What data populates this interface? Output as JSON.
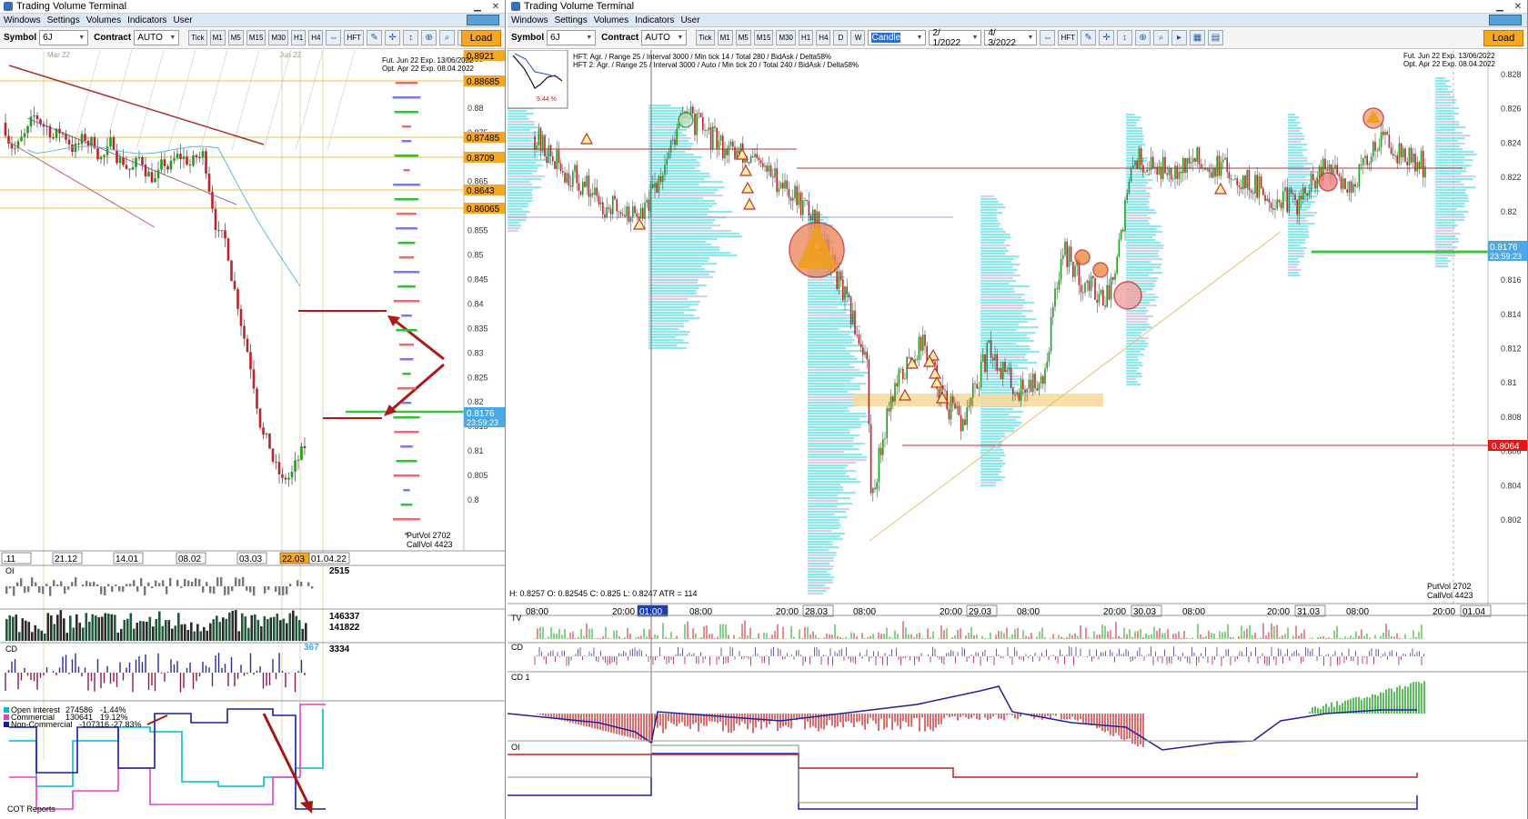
{
  "left_window": {
    "title": "Trading Volume Terminal",
    "menu": [
      "Windows",
      "Settings",
      "Volumes",
      "Indicators",
      "User"
    ],
    "toolbar": {
      "symbol_label": "Symbol",
      "symbol_value": "6J",
      "contract_label": "Contract",
      "contract_value": "AUTO",
      "timeframes": [
        "Tick",
        "M1",
        "M5",
        "M15",
        "M30",
        "H1",
        "H4"
      ],
      "hft_label": "HFT",
      "load_label": "Load"
    },
    "info": [
      "Fut. Jun 22 Exp. 13/06/2022",
      "Opt. Apr 22 Exp. 08.04.2022"
    ],
    "price_axis": [
      "0.89",
      "0.885",
      "0.88",
      "0.875",
      "0.87",
      "0.865",
      "0.86",
      "0.855",
      "0.85",
      "0.845",
      "0.84",
      "0.835",
      "0.83",
      "0.825",
      "0.82",
      "0.815",
      "0.81",
      "0.805",
      "0.8"
    ],
    "price_labels": [
      {
        "text": "0.8921",
        "color": "#f5a623"
      },
      {
        "text": "0.88685",
        "color": "#f5a623"
      },
      {
        "text": "0.87485",
        "color": "#f5a623"
      },
      {
        "text": "0.8709",
        "color": "#f5a623"
      },
      {
        "text": "0.8643",
        "color": "#f5a623"
      },
      {
        "text": "0.86065",
        "color": "#f5a623"
      }
    ],
    "current_price": "0.8176",
    "countdown": "23:59:23",
    "put_vol": "PutVol  2702",
    "call_vol": "CallVol  4423",
    "time_axis": [
      ".11",
      "21.12",
      "14.01",
      "08.02",
      "03.03",
      "22.03",
      "01.04.22"
    ],
    "oi_label": "OI",
    "oi_value": "2515",
    "vol_values": [
      "146337",
      "141822"
    ],
    "cd_label": "CD",
    "cd_value": "3334",
    "cd_badge": "367",
    "cot_legend": [
      {
        "label": "Open interest",
        "value": "274586",
        "pct": "-1.44%",
        "color": "#00bcd4"
      },
      {
        "label": "Commercial",
        "value": "130641",
        "pct": "19.12%",
        "color": "#e040c8"
      },
      {
        "label": "Non-Commercial",
        "value": "-107316",
        "pct": "-27.83%",
        "color": "#1a1aa8"
      }
    ],
    "cot_title": "COT Reports",
    "chart_top_tags": [
      "Mar 22",
      "Jun 22"
    ]
  },
  "right_window": {
    "title": "Trading Volume Terminal",
    "menu": [
      "Windows",
      "Settings",
      "Volumes",
      "Indicators",
      "User"
    ],
    "toolbar": {
      "symbol_label": "Symbol",
      "symbol_value": "6J",
      "contract_label": "Contract",
      "contract_value": "AUTO",
      "timeframes": [
        "Tick",
        "M1",
        "M5",
        "M15",
        "M30",
        "H1",
        "H4",
        "D",
        "W"
      ],
      "chart_mode": "Candle",
      "date_from": "2/ 1/2022",
      "date_to": "4/ 3/2022",
      "hft_label": "HFT",
      "load_label": "Load"
    },
    "hft_info": [
      "HFT: Agr. / Range 25 / Interval 3000 / Min tick 14 / Total 280 / BidAsk / Delta58%",
      "HFT 2: Agr. / Range 25 / Interval 3000 / Auto / Min tick 20 / Total 240 / BidAsk / Delta58%"
    ],
    "info": [
      "Fut. Jun 22 Exp. 13/06/2022",
      "Opt. Apr 22 Exp. 08.04.2022"
    ],
    "mini_chart_pct": "9.44 %",
    "price_axis": [
      "0.828",
      "0.826",
      "0.824",
      "0.822",
      "0.82",
      "0.818",
      "0.816",
      "0.814",
      "0.812",
      "0.81",
      "0.808",
      "0.806",
      "0.804",
      "0.802"
    ],
    "current_price": "0.8176",
    "countdown": "23:59:23",
    "red_level": "0.8064",
    "ohlc": "H: 0.8257   O: 0.82545   C: 0.825   L: 0.8247   ATR = 114",
    "put_vol": "PutVol  2702",
    "call_vol": "CallVol  4423",
    "time_axis": [
      "08:00",
      "20:00",
      "01:00",
      "08:00",
      "20:00",
      "28.03",
      "08:00",
      "20:00",
      "29.03",
      "08:00",
      "20:00",
      "30.03",
      "08:00",
      "20:00",
      "31.03",
      "08:00",
      "20:00",
      "01.04"
    ],
    "tv_label": "TV",
    "cd_label": "CD",
    "cd1_label": "CD 1",
    "oi_label": "OI"
  },
  "colors": {
    "accent_orange": "#f5a623",
    "price_blue": "#4aa8e6",
    "bull": "#18a018",
    "bear": "#c0202a",
    "profile_cyan": "#7fe7ee",
    "profile_purple": "#d6c8ea",
    "menu_bg": "#dbe8f6"
  },
  "icons": [
    "minimize-icon",
    "close-icon",
    "restore-icon",
    "crosshair-icon",
    "zoom-icon",
    "pen-icon",
    "arrows-icon"
  ]
}
